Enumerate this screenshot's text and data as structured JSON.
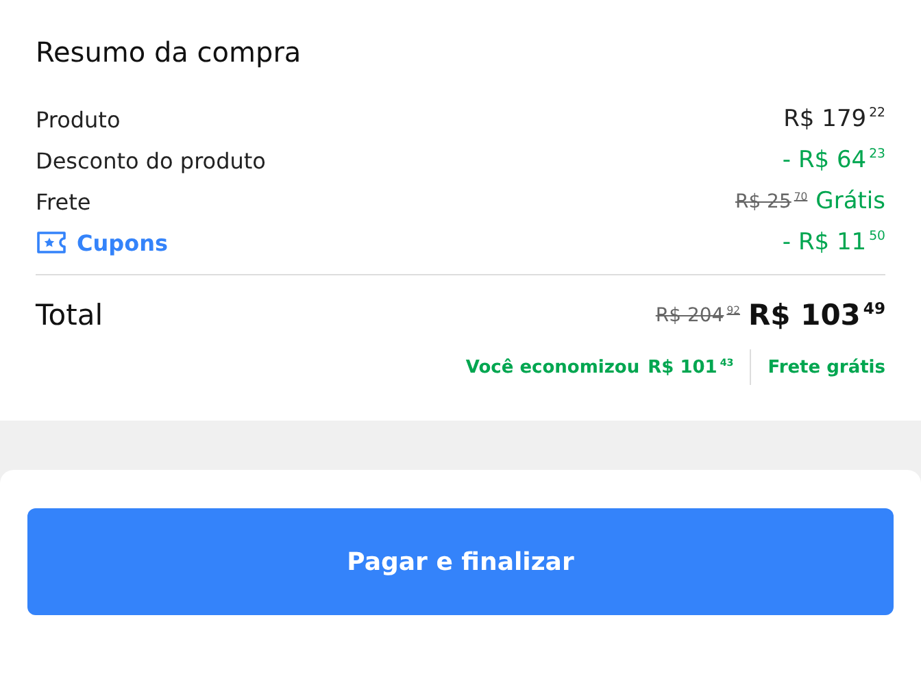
{
  "title": "Resumo da compra",
  "rows": [
    {
      "kind": "plain",
      "label": "Produto",
      "value": "R$ 179$^{22}$"
    },
    {
      "kind": "discount",
      "label": "Desconto do produto",
      "value": "- R$ 64$^{23}$"
    },
    {
      "kind": "shipping",
      "label": "Frete",
      "old_value": "R$ 25$^{70}$",
      "value": "Grátis"
    },
    {
      "kind": "coupon",
      "label": "Cupons",
      "value": "- R$ 11$^{50}$"
    }
  ],
  "total": {
    "label": "Total",
    "old_value": "R$ 204$^{92}$",
    "value": "R$ 103$^{49}$"
  },
  "savings": {
    "text": "Você economizou",
    "amount": "R$ 101$^{43}$",
    "shipping": "Frete grátis"
  },
  "button": "Pagar e finalizar"
}
